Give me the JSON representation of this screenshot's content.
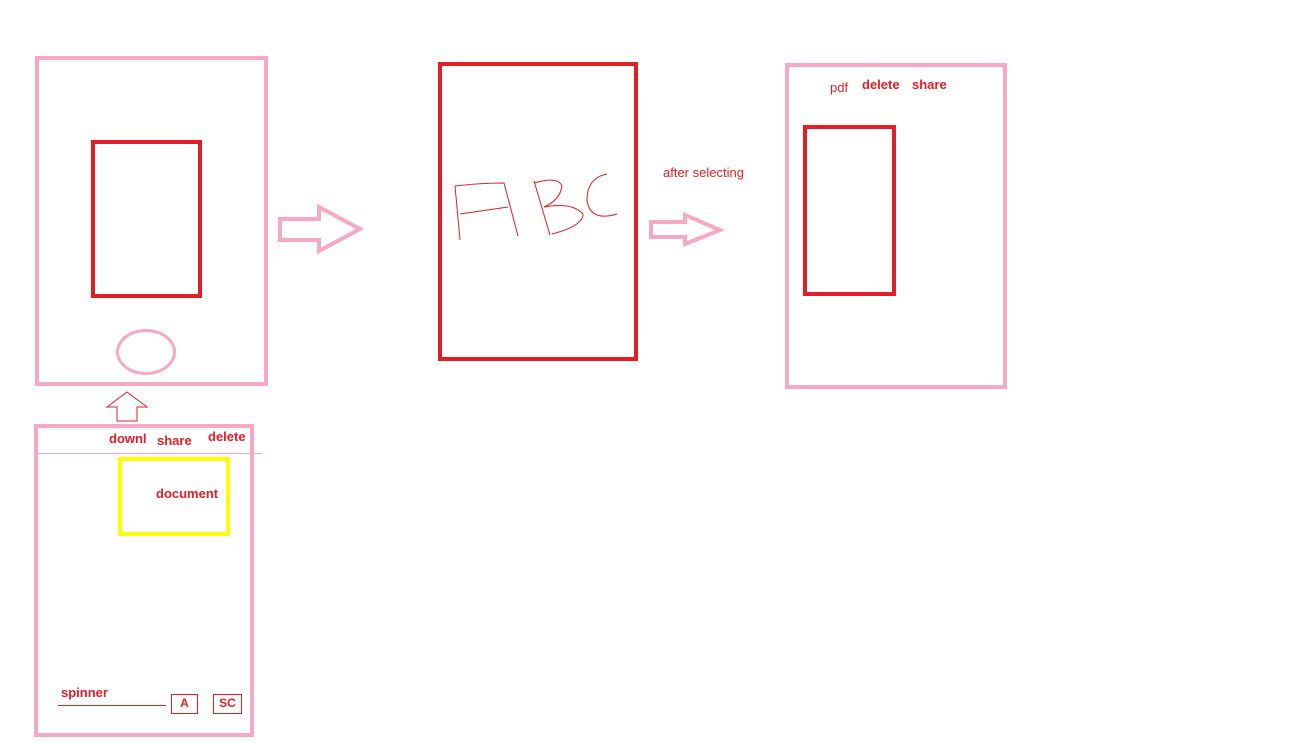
{
  "main_screen": {
    "phone_frame": "phone-frame",
    "home_button": "home-button"
  },
  "list_screen": {
    "toolbar": {
      "download_label": "downl",
      "share_label": "share",
      "delete_label": "delete"
    },
    "document_label": "document",
    "spinner_label": "spinner",
    "button_a_label": "A",
    "button_sc_label": "SC"
  },
  "preview_screen": {
    "handwriting": "ABC"
  },
  "annotation": {
    "after_selecting": "after selecting"
  },
  "selected_screen": {
    "toolbar": {
      "pdf_label": "pdf",
      "delete_label": "delete",
      "share_label": "share"
    }
  },
  "colors": {
    "pink": "#f7a8c4",
    "red": "#e31e24",
    "yellow": "#ffff00"
  }
}
